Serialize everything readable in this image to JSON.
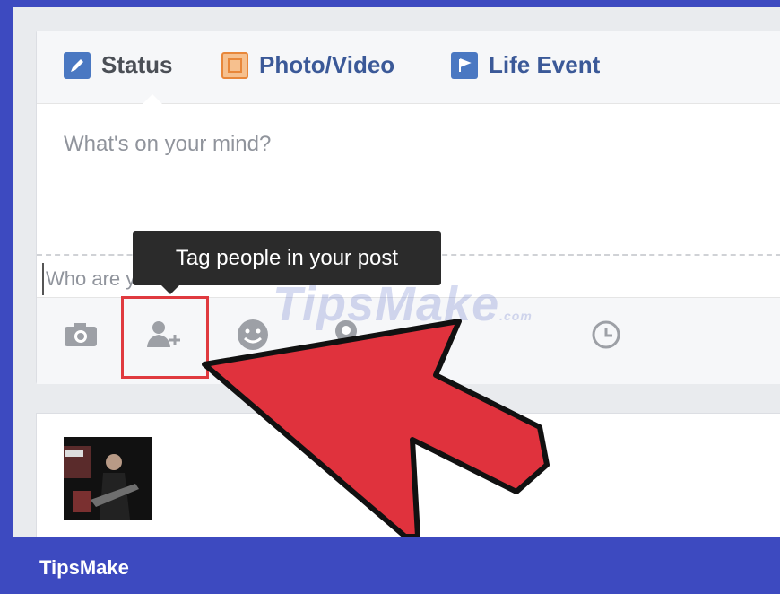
{
  "tabs": [
    {
      "label": "Status",
      "icon": "pencil-icon",
      "color": "#4a78c2"
    },
    {
      "label": "Photo/Video",
      "icon": "photo-icon",
      "color": "#e8873a"
    },
    {
      "label": "Life Event",
      "icon": "flag-icon",
      "color": "#4a78c2"
    }
  ],
  "composer": {
    "placeholder": "What's on your mind?",
    "with_placeholder": "Who are you with?"
  },
  "tooltip": {
    "text": "Tag people in your post"
  },
  "toolbar": {
    "icons": [
      "camera-icon",
      "tag-people-icon",
      "emoji-icon",
      "location-icon",
      "clock-icon"
    ]
  },
  "watermark": {
    "text": "TipsMake",
    "suffix": ".com"
  },
  "footer": {
    "brand": "TipsMake"
  },
  "colors": {
    "frame": "#3d4ac0",
    "highlight": "#e03a3f",
    "arrow": "#e0323d",
    "tooltip": "#2b2b2b"
  }
}
